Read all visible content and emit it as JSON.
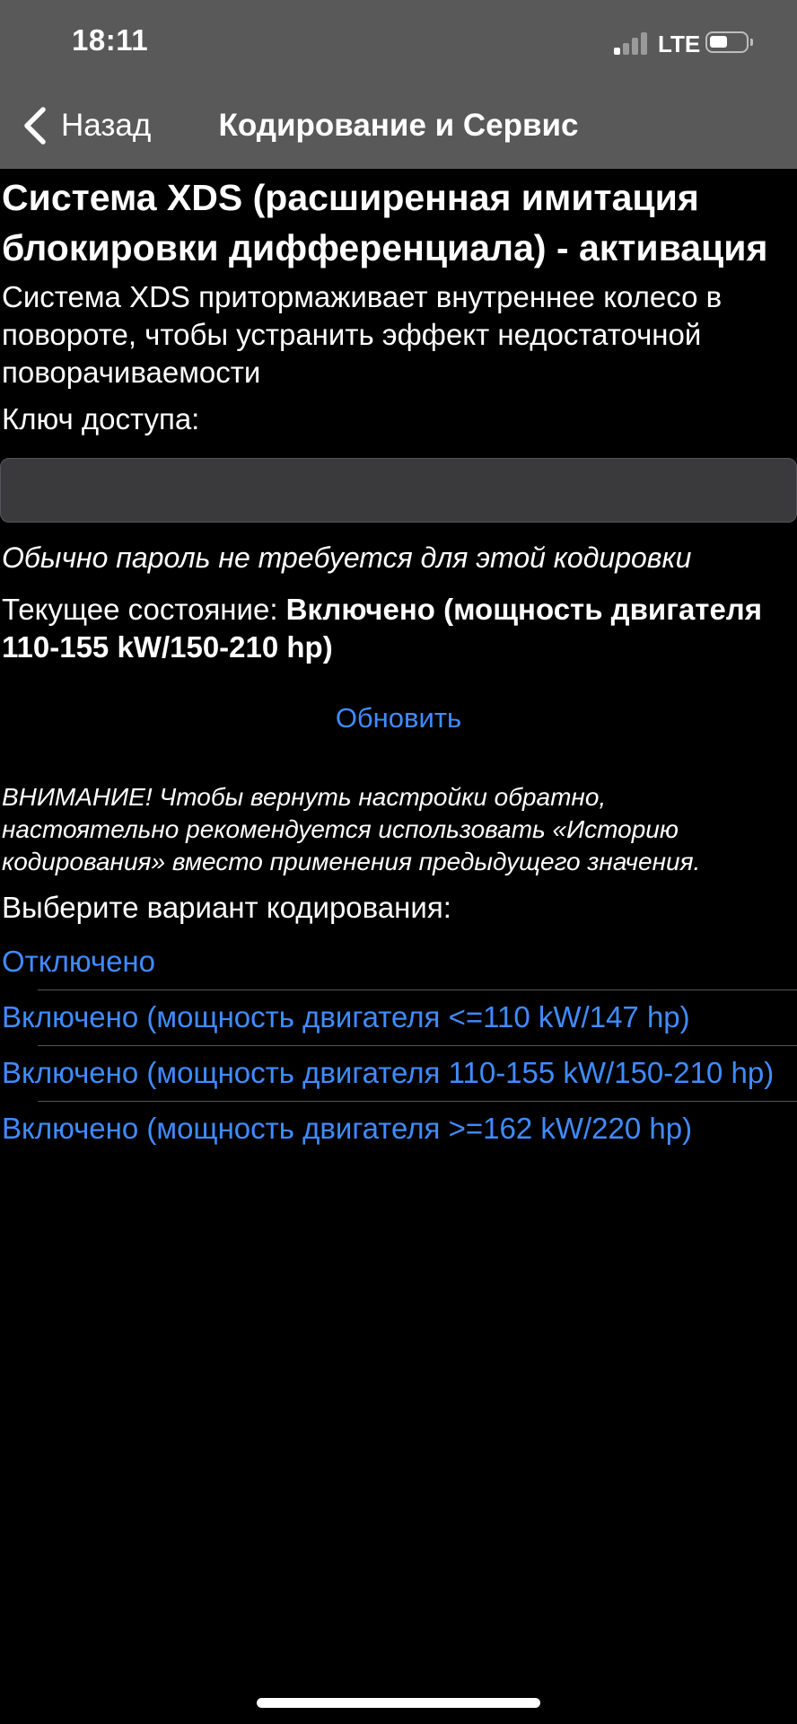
{
  "status_bar": {
    "time": "18:11",
    "network": "LTE",
    "signal_bars_active": 1,
    "signal_bars_total": 4,
    "battery_level": 0.4,
    "signal_icon": "signal-icon",
    "battery_icon": "battery-icon"
  },
  "nav": {
    "back_label": "Назад",
    "back_icon": "chevron-left-icon",
    "title": "Кодирование и Сервис"
  },
  "page": {
    "title": "Система XDS (расширенная имитация блокировки дифференциала) - активация",
    "description": "Система XDS притормаживает внутреннее колесо в повороте, чтобы устранить эффект недостаточной поворачиваемости",
    "key_label": "Ключ доступа:",
    "key_value": "",
    "hint": "Обычно пароль не требуется для этой кодировки",
    "current_state_label": "Текущее состояние: ",
    "current_state_value": "Включено (мощность двигателя 110-155 kW/150-210 hp)",
    "refresh_label": "Обновить",
    "warning": "ВНИМАНИЕ! Чтобы вернуть настройки обратно, настоятельно рекомендуется использовать «Историю кодирования» вместо применения предыдущего значения.",
    "choose_label": "Выберите вариант кодирования:",
    "options": [
      "Отключено",
      "Включено (мощность двигателя <=110 kW/147 hp)",
      "Включено (мощность двигателя 110-155 kW/150-210 hp)",
      "Включено (мощность двигателя >=162 kW/220 hp)"
    ]
  },
  "colors": {
    "background": "#000000",
    "nav_bar": "#595959",
    "link": "#3f8cff",
    "input_bg": "#3a3a3c"
  }
}
